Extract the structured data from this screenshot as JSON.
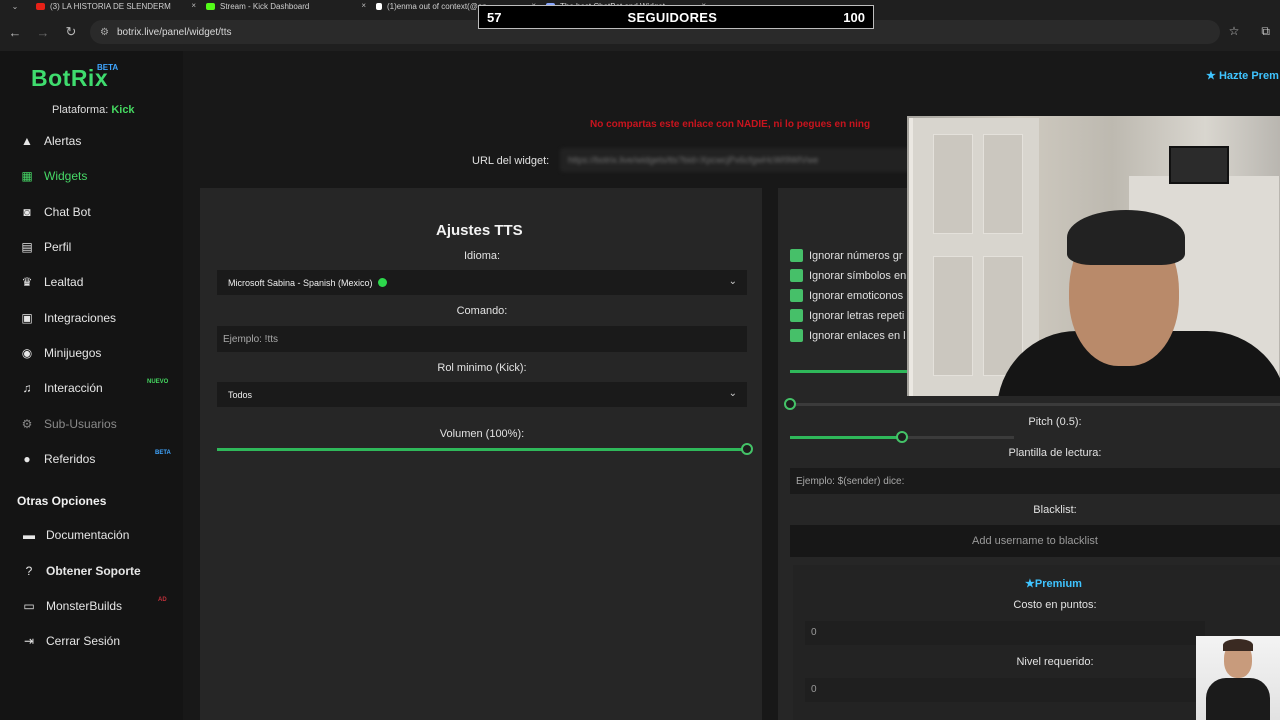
{
  "browser": {
    "tabs": [
      {
        "label": "(3) LA HISTORIA DE SLENDERM",
        "color": "#e62117"
      },
      {
        "label": "Stream - Kick Dashboard",
        "color": "#53fc18"
      },
      {
        "label": "(1)enma out of context(@en",
        "color": "#ffffff"
      },
      {
        "label": "The best ChatBot and Widget",
        "color": "#8aa8ff"
      }
    ],
    "tab_close": "×",
    "url": "botrix.live/panel/widget/tts"
  },
  "overlay": {
    "left_value": "57",
    "label": "SEGUIDORES",
    "right_value": "100"
  },
  "sidebar": {
    "logo": "BotRix",
    "logo_badge": "BETA",
    "platform_label": "Plataforma:",
    "platform_value": "Kick",
    "items": [
      {
        "label": "Alertas",
        "icon": "warning-icon"
      },
      {
        "label": "Widgets",
        "icon": "grid-icon"
      },
      {
        "label": "Chat Bot",
        "icon": "robot-icon"
      },
      {
        "label": "Perfil",
        "icon": "profile-card-icon"
      },
      {
        "label": "Lealtad",
        "icon": "trophy-icon"
      },
      {
        "label": "Integraciones",
        "icon": "integrations-icon"
      },
      {
        "label": "Minijuegos",
        "icon": "gamepad-icon"
      },
      {
        "label": "Interacción",
        "icon": "music-icon",
        "badge": "NUEVO"
      },
      {
        "label": "Sub-Usuarios",
        "icon": "users-cog-icon"
      },
      {
        "label": "Referidos",
        "icon": "users-icon",
        "badge": "BETA"
      }
    ],
    "section_title": "Otras Opciones",
    "other_items": [
      {
        "label": "Documentación",
        "icon": "book-icon"
      },
      {
        "label": "Obtener Soporte",
        "icon": "help-icon"
      },
      {
        "label": "MonsterBuilds",
        "icon": "laptop-icon",
        "badge": "AD"
      },
      {
        "label": "Cerrar Sesión",
        "icon": "logout-icon"
      }
    ]
  },
  "header": {
    "premium_cta": "Hazte Prem"
  },
  "main": {
    "warning": "No compartas este enlace con NADIE, ni lo pegues en ning",
    "widget_url_label": "URL del widget:",
    "widget_url_value": "https://botrix.live/widgets/tts?bid=XpcwcjPx6cfgwHcWI9WIVwe",
    "tts": {
      "title": "Ajustes TTS",
      "idioma_label": "Idioma:",
      "idioma_value": "Microsoft Sabina - Spanish (Mexico)",
      "comando_label": "Comando:",
      "comando_placeholder": "Ejemplo: !tts",
      "rol_label": "Rol minimo (Kick):",
      "rol_value": "Todos",
      "volumen_label": "Volumen (100%):",
      "volumen_value": 1.0
    },
    "right": {
      "checkboxes": [
        "Ignorar números gr",
        "Ignorar símbolos en",
        "Ignorar emoticonos",
        "Ignorar letras repeti",
        "Ignorar enlaces en l"
      ],
      "pitch_label": "Pitch (0.5):",
      "pitch_value": 0.5,
      "plantilla_label": "Plantilla de lectura:",
      "plantilla_placeholder": "Ejemplo: $(sender) dice:",
      "blacklist_label": "Blacklist:",
      "blacklist_button": "Add username to blacklist",
      "premium_title": "Premium",
      "costo_label": "Costo en puntos:",
      "costo_value": "0",
      "nivel_label": "Nivel requerido:",
      "nivel_value": "0"
    }
  }
}
